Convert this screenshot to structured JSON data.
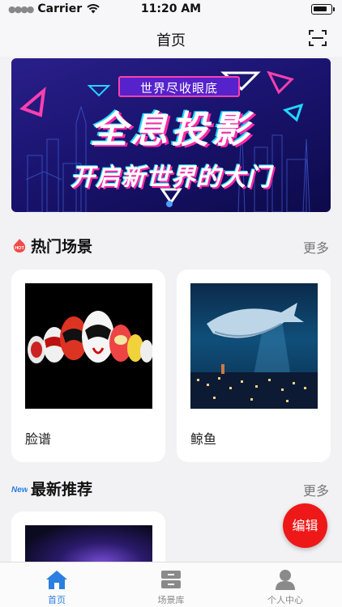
{
  "status_bar": {
    "carrier": "Carrier",
    "time": "11:20 AM",
    "battery_level": 0.85
  },
  "nav": {
    "title": "首页",
    "scan_icon": "scan-icon"
  },
  "banner": {
    "subtitle": "世界尽收眼底",
    "title": "全息投影",
    "tagline": "开启新世界的大门",
    "page_dots": 1
  },
  "hot_section": {
    "badge": "HOT",
    "title": "热门场景",
    "more": "更多",
    "items": [
      {
        "label": "脸谱"
      },
      {
        "label": "鲸鱼"
      }
    ]
  },
  "new_section": {
    "badge": "New",
    "title": "最新推荐",
    "more": "更多"
  },
  "fab": {
    "label": "编辑",
    "color": "#ee1818"
  },
  "tabs": [
    {
      "label": "首页",
      "icon": "home-icon",
      "active": true
    },
    {
      "label": "场景库",
      "icon": "archive-icon",
      "active": false
    },
    {
      "label": "个人中心",
      "icon": "person-icon",
      "active": false
    }
  ],
  "colors": {
    "accent": "#2a7fe0",
    "background": "#f2f2f4"
  }
}
